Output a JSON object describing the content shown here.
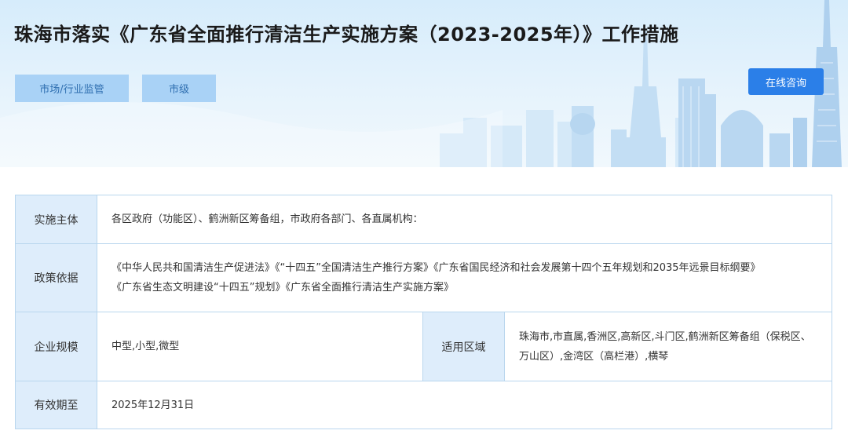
{
  "header": {
    "title": "珠海市落实《广东省全面推行清洁生产实施方案（2023-2025年）》工作措施",
    "tags": [
      "市场/行业监管",
      "市级"
    ],
    "consult_button": "在线咨询"
  },
  "details": {
    "implementer_label": "实施主体",
    "implementer_value": "各区政府（功能区）、鹤洲新区筹备组，市政府各部门、各直属机构：",
    "basis_label": "政策依据",
    "basis_line1": "《中华人民共和国清洁生产促进法》《“十四五”全国清洁生产推行方案》《广东省国民经济和社会发展第十四个五年规划和2035年远景目标纲要》",
    "basis_line2": "《广东省生态文明建设“十四五”规划》《广东省全面推行清洁生产实施方案》",
    "scale_label": "企业规模",
    "scale_value": "中型,小型,微型",
    "region_label": "适用区域",
    "region_value": "珠海市,市直属,香洲区,高新区,斗门区,鹤洲新区筹备组（保税区、万山区）,金湾区（高栏港）,横琴",
    "validity_label": "有效期至",
    "validity_value": "2025年12月31日"
  }
}
